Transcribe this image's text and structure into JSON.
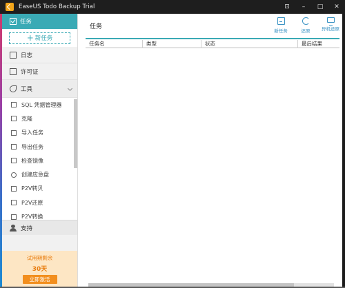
{
  "window": {
    "title": "EaseUS Todo Backup Trial",
    "controls": [
      "⊡",
      "–",
      "□",
      "✕"
    ]
  },
  "sidebar": {
    "active_item": "任务",
    "new_task_button": "新任务",
    "items": [
      {
        "label": "日志",
        "icon": "log-icon"
      },
      {
        "label": "许可证",
        "icon": "license-icon"
      },
      {
        "label": "工具",
        "icon": "wrench-icon"
      }
    ],
    "tools": [
      {
        "label": "SQL 凭据管理器",
        "icon": "sql-icon"
      },
      {
        "label": "克隆",
        "icon": "clone-icon"
      },
      {
        "label": "导入任务",
        "icon": "import-icon"
      },
      {
        "label": "导出任务",
        "icon": "export-icon"
      },
      {
        "label": "检查镜像",
        "icon": "check-image-icon"
      },
      {
        "label": "创建应急盘",
        "icon": "emergency-disk-icon"
      },
      {
        "label": "P2V转贝",
        "icon": "p2v-copy-icon"
      },
      {
        "label": "P2V还原",
        "icon": "p2v-restore-icon"
      },
      {
        "label": "P2V转换",
        "icon": "p2v-convert-icon"
      }
    ],
    "support": "支持",
    "trial": {
      "remaining_label": "试用期剩余",
      "days": "30天",
      "buy_button": "立即激活"
    }
  },
  "main": {
    "title": "任务",
    "toolbar": [
      {
        "label": "新任务",
        "icon": "new-task-icon"
      },
      {
        "label": "还原",
        "icon": "restore-icon"
      },
      {
        "label": "异机还原",
        "icon": "bare-metal-restore-icon"
      }
    ],
    "columns": [
      "任务名",
      "类型",
      "状态",
      "最后结果"
    ]
  },
  "colors": {
    "accent": "#3aaab5",
    "trial_bg": "#fde6c4",
    "trial_text": "#e87d10",
    "titlebar": "#1e1e1e"
  }
}
